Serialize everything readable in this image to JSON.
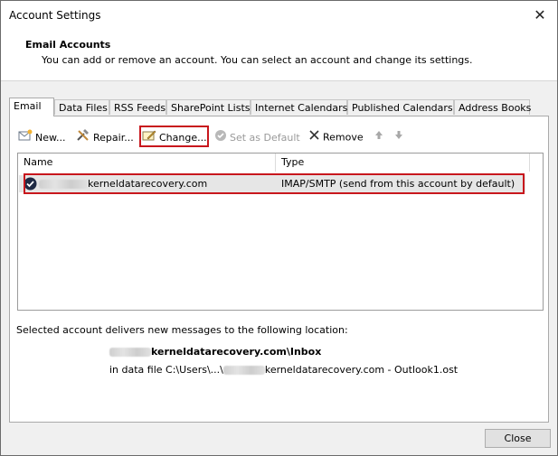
{
  "window": {
    "title": "Account Settings",
    "close_glyph": "✕"
  },
  "header": {
    "title": "Email Accounts",
    "subtitle": "You can add or remove an account. You can select an account and change its settings."
  },
  "tabs": [
    {
      "label": "Email",
      "active": true
    },
    {
      "label": "Data Files"
    },
    {
      "label": "RSS Feeds"
    },
    {
      "label": "SharePoint Lists"
    },
    {
      "label": "Internet Calendars"
    },
    {
      "label": "Published Calendars"
    },
    {
      "label": "Address Books"
    }
  ],
  "toolbar": {
    "new_label": "New...",
    "repair_label": "Repair...",
    "change_label": "Change...",
    "set_default_label": "Set as Default",
    "remove_label": "Remove"
  },
  "accounts_list": {
    "columns": {
      "name": "Name",
      "type": "Type"
    },
    "rows": [
      {
        "name_suffix": "kerneldatarecovery.com",
        "type": "IMAP/SMTP (send from this account by default)"
      }
    ]
  },
  "delivery": {
    "label": "Selected account delivers new messages to the following location:",
    "folder_suffix": "kerneldatarecovery.com\\Inbox",
    "datafile_prefix": "in data file C:\\Users\\...\\",
    "datafile_suffix": "kerneldatarecovery.com - Outlook1.ost"
  },
  "footer": {
    "close_label": "Close"
  },
  "colors": {
    "highlight": "#c8171d",
    "selected_row": "#e6e6e6"
  }
}
